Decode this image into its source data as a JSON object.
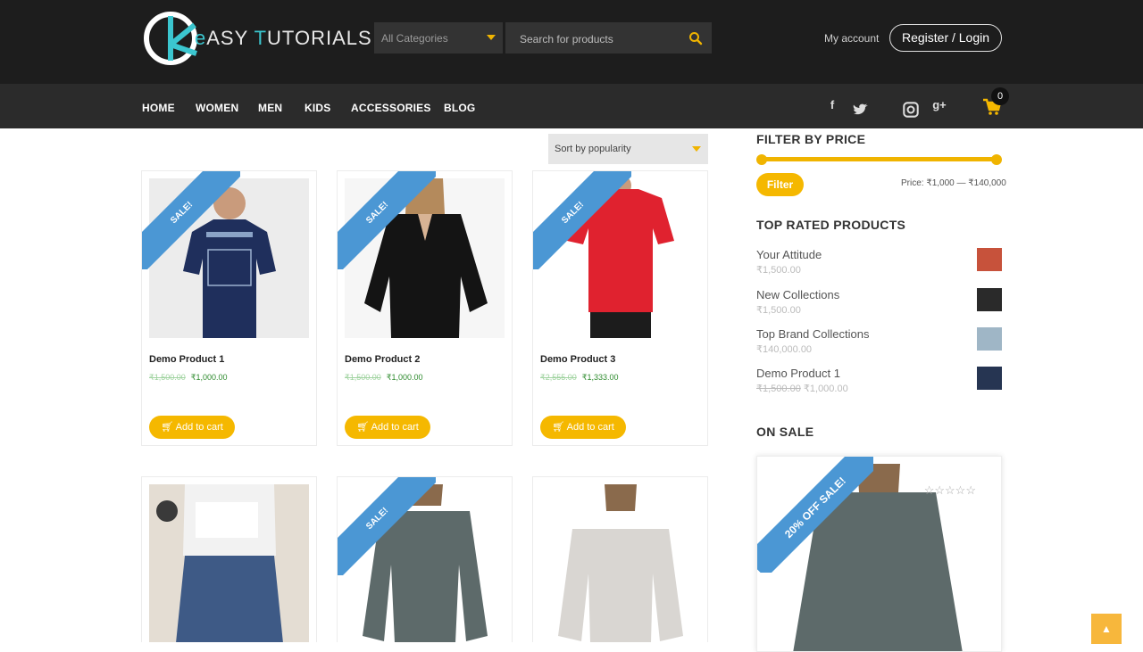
{
  "brand": {
    "logo_prefix": "e",
    "logo_word": "ASY ",
    "logo_accent": "T",
    "logo_rest": "UTORIALS"
  },
  "header": {
    "category_select": "All Categories",
    "search_placeholder": "Search for products",
    "my_account": "My account",
    "register_login": "Register / Login"
  },
  "nav": {
    "items": [
      "HOME",
      "WOMEN",
      "MEN",
      "KIDS",
      "ACCESSORIES",
      "BLOG"
    ],
    "social": [
      "facebook-icon",
      "twitter-icon",
      "instagram-icon",
      "google-plus-icon"
    ],
    "cart_count": "0"
  },
  "shop": {
    "sort_label": "Sort by popularity",
    "sale_label": "SALE!",
    "add_to_cart": "Add to cart",
    "products": [
      {
        "name": "Demo Product 1",
        "old_price": "₹1,500.00",
        "new_price": "₹1,000.00"
      },
      {
        "name": "Demo Product 2",
        "old_price": "₹1,500.00",
        "new_price": "₹1,000.00"
      },
      {
        "name": "Demo Product 3",
        "old_price": "₹2,555.00",
        "new_price": "₹1,333.00"
      }
    ]
  },
  "sidebar": {
    "filter_title": "FILTER BY PRICE",
    "filter_button": "Filter",
    "price_range": "Price: ₹1,000 — ₹140,000",
    "top_rated_title": "TOP RATED PRODUCTS",
    "top_rated": [
      {
        "name": "Your Attitude",
        "price": "₹1,500.00"
      },
      {
        "name": "New Collections",
        "price": "₹1,500.00"
      },
      {
        "name": "Top Brand Collections",
        "price": "₹140,000.00"
      },
      {
        "name": "Demo Product 1",
        "old_price": "₹1,500.00",
        "price": "₹1,000.00"
      }
    ],
    "on_sale_title": "ON SALE",
    "on_sale_ribbon": "20% OFF SALE!",
    "on_sale_stars": "☆☆☆☆☆"
  },
  "colors": {
    "accent_yellow": "#f5b800",
    "ribbon_blue": "#4b97d4",
    "header_dark": "#1d1d1d",
    "nav_dark": "#2b2b2b",
    "logo_teal": "#3bc6cf"
  }
}
